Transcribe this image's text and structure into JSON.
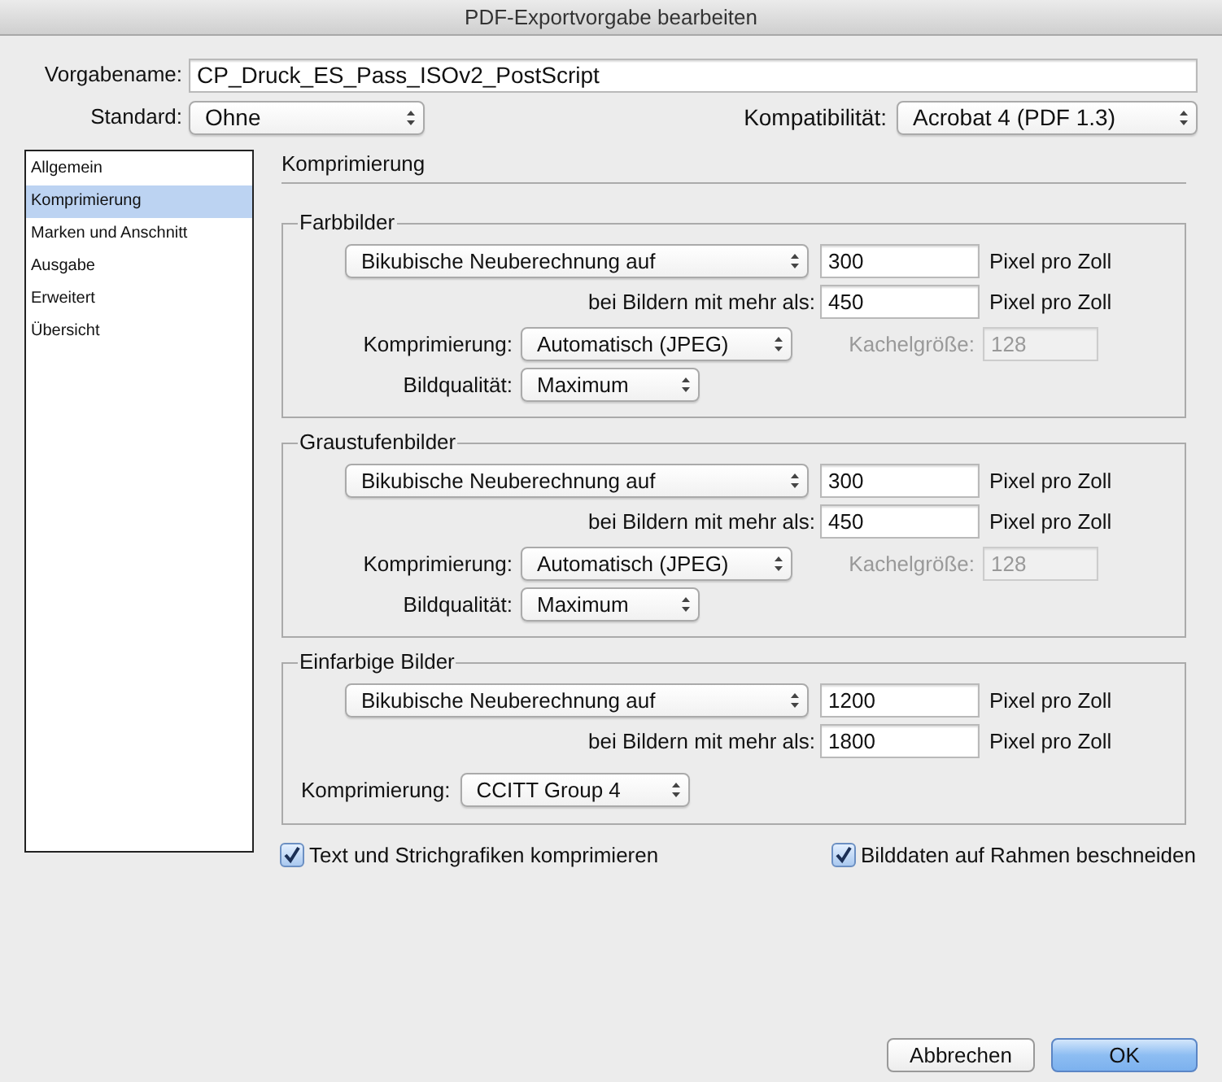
{
  "window": {
    "title": "PDF-Exportvorgabe bearbeiten"
  },
  "preset": {
    "label": "Vorgabename:",
    "value": "CP_Druck_ES_Pass_ISOv2_PostScript"
  },
  "standard": {
    "label": "Standard:",
    "value": "Ohne"
  },
  "compatibility": {
    "label": "Kompatibilität:",
    "value": "Acrobat 4 (PDF 1.3)"
  },
  "sidebar": {
    "items": [
      {
        "label": "Allgemein",
        "selected": false
      },
      {
        "label": "Komprimierung",
        "selected": true
      },
      {
        "label": "Marken und Anschnitt",
        "selected": false
      },
      {
        "label": "Ausgabe",
        "selected": false
      },
      {
        "label": "Erweitert",
        "selected": false
      },
      {
        "label": "Übersicht",
        "selected": false
      }
    ]
  },
  "section_title": "Komprimierung",
  "groups": [
    {
      "kind": "full",
      "title": "Farbbilder",
      "resample": "Bikubische Neuberechnung auf",
      "resolution": "300",
      "unit": "Pixel pro Zoll",
      "threshold_label": "bei Bildern mit mehr als:",
      "threshold": "450",
      "threshold_unit": "Pixel pro Zoll",
      "compression_label": "Komprimierung:",
      "compression": "Automatisch (JPEG)",
      "tile_label": "Kachelgröße:",
      "tile": "128",
      "tile_disabled": true,
      "quality_label": "Bildqualität:",
      "quality": "Maximum"
    },
    {
      "kind": "full",
      "title": "Graustufenbilder",
      "resample": "Bikubische Neuberechnung auf",
      "resolution": "300",
      "unit": "Pixel pro Zoll",
      "threshold_label": "bei Bildern mit mehr als:",
      "threshold": "450",
      "threshold_unit": "Pixel pro Zoll",
      "compression_label": "Komprimierung:",
      "compression": "Automatisch (JPEG)",
      "tile_label": "Kachelgröße:",
      "tile": "128",
      "tile_disabled": true,
      "quality_label": "Bildqualität:",
      "quality": "Maximum"
    },
    {
      "kind": "mono",
      "title": "Einfarbige Bilder",
      "resample": "Bikubische Neuberechnung auf",
      "resolution": "1200",
      "unit": "Pixel pro Zoll",
      "threshold_label": "bei Bildern mit mehr als:",
      "threshold": "1800",
      "threshold_unit": "Pixel pro Zoll",
      "compression_label": "Komprimierung:",
      "compression": "CCITT Group 4"
    }
  ],
  "options": [
    {
      "label": "Text und Strichgrafiken komprimieren",
      "checked": true
    },
    {
      "label": "Bilddaten auf Rahmen beschneiden",
      "checked": true
    }
  ],
  "buttons": [
    {
      "label": "Abbrechen",
      "kind": "cancel"
    },
    {
      "label": "OK",
      "kind": "default"
    }
  ]
}
